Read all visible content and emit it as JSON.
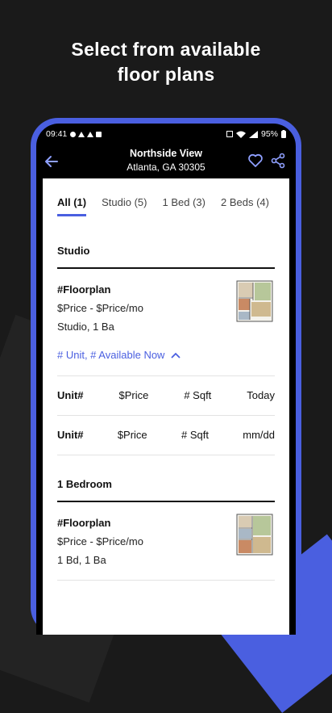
{
  "headline": {
    "line1": "Select from available",
    "line2": "floor plans"
  },
  "statusbar": {
    "time": "09:41",
    "battery": "95%"
  },
  "appbar": {
    "title": "Northside View",
    "subtitle": "Atlanta, GA 30305"
  },
  "tabs": [
    {
      "label": "All (1)",
      "active": true
    },
    {
      "label": "Studio (5)",
      "active": false
    },
    {
      "label": "1 Bed (3)",
      "active": false
    },
    {
      "label": "2 Beds (4)",
      "active": false
    }
  ],
  "sections": [
    {
      "title": "Studio",
      "floorplan": {
        "name": "#Floorplan",
        "price": "$Price - $Price/mo",
        "details": "Studio, 1 Ba",
        "availability": "# Unit, # Available Now"
      },
      "units": [
        {
          "unit": "Unit#",
          "price": "$Price",
          "sqft": "# Sqft",
          "date": "Today"
        },
        {
          "unit": "Unit#",
          "price": "$Price",
          "sqft": "# Sqft",
          "date": "mm/dd"
        }
      ]
    },
    {
      "title": "1 Bedroom",
      "floorplan": {
        "name": "#Floorplan",
        "price": "$Price - $Price/mo",
        "details": "1 Bd, 1 Ba"
      }
    }
  ],
  "colors": {
    "accent": "#4a5fe0",
    "background": "#1a1a1a"
  }
}
